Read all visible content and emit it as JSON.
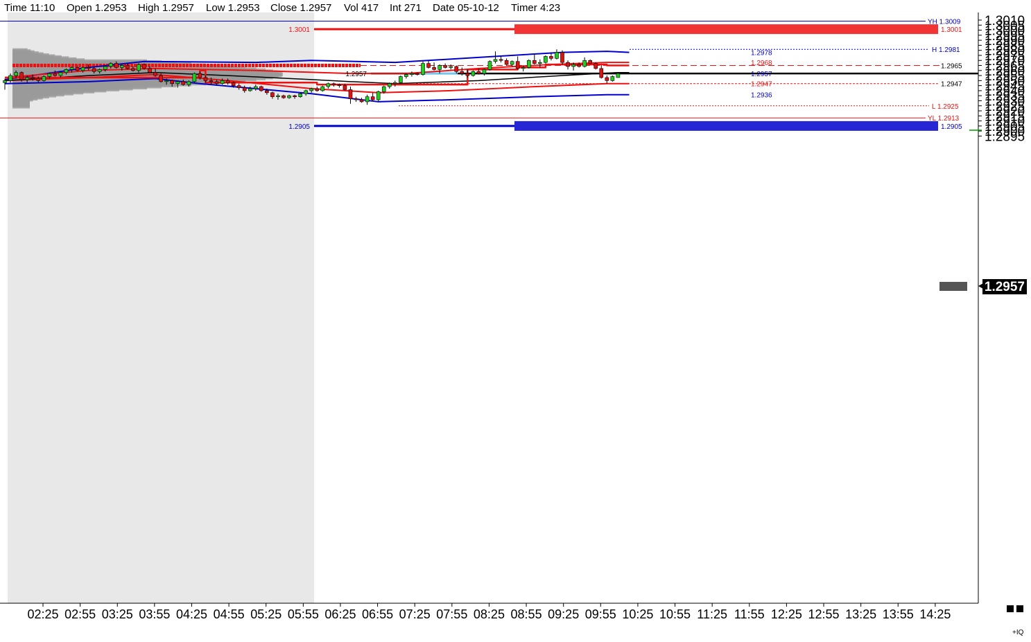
{
  "header": {
    "time": "Time 11:10",
    "open": "Open 1.2953",
    "high": "High 1.2957",
    "low": "Low 1.2953",
    "close": "Close 1.2957",
    "vol": "Vol 417",
    "int": "Int 271",
    "date": "Date 05-10-12",
    "timer": "Timer 4:23"
  },
  "corner_label": "+IQ",
  "colors": {
    "red": "#ee1111",
    "blue": "#0000cc",
    "black": "#000000",
    "green": "#22cc22",
    "candle_red": "#dd1111",
    "profile_gray": "#9a9a9a",
    "shade": "#e8e8e8"
  },
  "chart_data": {
    "type": "candlestick",
    "ylim": [
      1.2893,
      1.3013
    ],
    "y_ticks": [
      "1.3010",
      "1.3005",
      "1.3000",
      "1.2995",
      "1.2990",
      "1.2985",
      "1.2980",
      "1.2975",
      "1.2970",
      "1.2965",
      "1.2960",
      "1.2955",
      "1.2950",
      "1.2945",
      "1.2940",
      "1.2935",
      "1.2930",
      "1.2925",
      "1.2920",
      "1.2915",
      "1.2910",
      "1.2905",
      "1.2900",
      "1.2895"
    ],
    "x_ticks": [
      "02:25",
      "02:55",
      "03:25",
      "03:55",
      "04:25",
      "04:55",
      "05:25",
      "05:55",
      "06:25",
      "06:55",
      "07:25",
      "07:55",
      "08:25",
      "08:55",
      "09:25",
      "09:55",
      "10:25",
      "10:55",
      "11:25",
      "11:55",
      "12:25",
      "12:55",
      "13:25",
      "13:55",
      "14:25"
    ],
    "current_price": "1.2957",
    "levels": [
      {
        "name": "yh",
        "label": "YH 1.3009",
        "value": 1.3009,
        "color": "#0000cc"
      },
      {
        "name": "high",
        "label": "H 1.2981",
        "value": 1.2981,
        "color": "#0000cc"
      },
      {
        "name": "resist",
        "label": "1.3001",
        "value": 1.3001,
        "color": "#ee1111"
      },
      {
        "name": "poc",
        "label": "1.2965",
        "value": 1.2965,
        "color": "#ee1111"
      },
      {
        "name": "close",
        "label": "1.2957",
        "value": 1.2957,
        "color": "#000000"
      },
      {
        "name": "val",
        "label": "1.2947",
        "value": 1.2947,
        "color": "#ee1111"
      },
      {
        "name": "low",
        "label": "L 1.2925",
        "value": 1.2925,
        "color": "#ee1111"
      },
      {
        "name": "yl",
        "label": "YL 1.2913",
        "value": 1.2913,
        "color": "#ee1111"
      },
      {
        "name": "support",
        "label": "1.2905",
        "value": 1.2905,
        "color": "#0000cc"
      }
    ],
    "band_labels": [
      {
        "label": "1.2978",
        "value": 1.2978,
        "color": "#0000cc"
      },
      {
        "label": "1.2968",
        "value": 1.2968,
        "color": "#ee1111"
      },
      {
        "label": "1.2957",
        "value": 1.2957,
        "color": "#0000cc"
      },
      {
        "label": "1.2947",
        "value": 1.2947,
        "color": "#ee1111"
      },
      {
        "label": "1.2936",
        "value": 1.2936,
        "color": "#0000cc"
      }
    ],
    "candles": [
      [
        1.2948,
        1.2952,
        1.2941,
        1.295
      ],
      [
        1.295,
        1.2957,
        1.2948,
        1.2955
      ],
      [
        1.2955,
        1.296,
        1.2952,
        1.2958
      ],
      [
        1.2958,
        1.2959,
        1.2949,
        1.2951
      ],
      [
        1.2951,
        1.2955,
        1.2948,
        1.2953
      ],
      [
        1.2953,
        1.2956,
        1.295,
        1.2952
      ],
      [
        1.2952,
        1.2954,
        1.2948,
        1.295
      ],
      [
        1.295,
        1.2955,
        1.2949,
        1.2954
      ],
      [
        1.2954,
        1.2958,
        1.2952,
        1.2957
      ],
      [
        1.2957,
        1.296,
        1.2954,
        1.2955
      ],
      [
        1.2955,
        1.2959,
        1.2953,
        1.2958
      ],
      [
        1.2958,
        1.2962,
        1.2956,
        1.2961
      ],
      [
        1.2961,
        1.2964,
        1.2958,
        1.2963
      ],
      [
        1.2963,
        1.2965,
        1.2959,
        1.296
      ],
      [
        1.296,
        1.2964,
        1.2958,
        1.2963
      ],
      [
        1.2963,
        1.2966,
        1.296,
        1.2962
      ],
      [
        1.2962,
        1.2964,
        1.2957,
        1.2959
      ],
      [
        1.2959,
        1.2962,
        1.2957,
        1.2961
      ],
      [
        1.2961,
        1.2965,
        1.2959,
        1.2964
      ],
      [
        1.2964,
        1.2968,
        1.2962,
        1.2967
      ],
      [
        1.2967,
        1.2969,
        1.2962,
        1.2963
      ],
      [
        1.2963,
        1.2966,
        1.296,
        1.2965
      ],
      [
        1.2965,
        1.2967,
        1.2961,
        1.2962
      ],
      [
        1.2962,
        1.2964,
        1.2959,
        1.296
      ],
      [
        1.296,
        1.2967,
        1.2958,
        1.2966
      ],
      [
        1.2966,
        1.2967,
        1.2961,
        1.2962
      ],
      [
        1.2962,
        1.2964,
        1.2957,
        1.2958
      ],
      [
        1.2958,
        1.2962,
        1.2954,
        1.2955
      ],
      [
        1.2955,
        1.2957,
        1.2948,
        1.2949
      ],
      [
        1.2949,
        1.2952,
        1.2946,
        1.295
      ],
      [
        1.295,
        1.2951,
        1.2944,
        1.2947
      ],
      [
        1.2947,
        1.295,
        1.2943,
        1.2949
      ],
      [
        1.2949,
        1.2951,
        1.2945,
        1.2946
      ],
      [
        1.2946,
        1.295,
        1.2944,
        1.2949
      ],
      [
        1.2949,
        1.2958,
        1.2948,
        1.2957
      ],
      [
        1.2957,
        1.2959,
        1.2951,
        1.2953
      ],
      [
        1.2953,
        1.2955,
        1.2948,
        1.295
      ],
      [
        1.295,
        1.2953,
        1.2946,
        1.2949
      ],
      [
        1.2949,
        1.2951,
        1.2945,
        1.2947
      ],
      [
        1.2947,
        1.2952,
        1.2946,
        1.295
      ],
      [
        1.295,
        1.2952,
        1.2946,
        1.2948
      ],
      [
        1.2948,
        1.2949,
        1.2943,
        1.2945
      ],
      [
        1.2945,
        1.2947,
        1.2941,
        1.2943
      ],
      [
        1.2943,
        1.2945,
        1.2938,
        1.294
      ],
      [
        1.294,
        1.2944,
        1.2939,
        1.2942
      ],
      [
        1.2942,
        1.2946,
        1.294,
        1.2944
      ],
      [
        1.2944,
        1.2945,
        1.2939,
        1.294
      ],
      [
        1.294,
        1.2942,
        1.2936,
        1.2938
      ],
      [
        1.2938,
        1.2939,
        1.2932,
        1.2934
      ],
      [
        1.2934,
        1.2937,
        1.2931,
        1.2935
      ],
      [
        1.2935,
        1.2936,
        1.2932,
        1.2933
      ],
      [
        1.2933,
        1.2936,
        1.2932,
        1.2935
      ],
      [
        1.2935,
        1.2936,
        1.2932,
        1.2934
      ],
      [
        1.2934,
        1.2938,
        1.2933,
        1.2937
      ],
      [
        1.2937,
        1.2941,
        1.2935,
        1.294
      ],
      [
        1.294,
        1.2943,
        1.2938,
        1.2942
      ],
      [
        1.2942,
        1.2944,
        1.2939,
        1.294
      ],
      [
        1.294,
        1.2945,
        1.2939,
        1.2944
      ],
      [
        1.2944,
        1.2948,
        1.2942,
        1.2947
      ],
      [
        1.2947,
        1.2948,
        1.2944,
        1.2946
      ],
      [
        1.2946,
        1.2947,
        1.2943,
        1.2945
      ],
      [
        1.2945,
        1.2947,
        1.294,
        1.2941
      ],
      [
        1.2941,
        1.2944,
        1.2927,
        1.2932
      ],
      [
        1.2932,
        1.2934,
        1.2929,
        1.2931
      ],
      [
        1.2931,
        1.2933,
        1.2928,
        1.2929
      ],
      [
        1.2929,
        1.2936,
        1.2926,
        1.2934
      ],
      [
        1.2934,
        1.2938,
        1.293,
        1.2931
      ],
      [
        1.2931,
        1.294,
        1.2929,
        1.2939
      ],
      [
        1.2939,
        1.2945,
        1.2937,
        1.2944
      ],
      [
        1.2944,
        1.2948,
        1.2942,
        1.2947
      ],
      [
        1.2947,
        1.295,
        1.2944,
        1.2948
      ],
      [
        1.2948,
        1.2955,
        1.2947,
        1.2954
      ],
      [
        1.2954,
        1.2957,
        1.2952,
        1.2956
      ],
      [
        1.2956,
        1.2959,
        1.2954,
        1.2957
      ],
      [
        1.2957,
        1.2958,
        1.2955,
        1.2956
      ],
      [
        1.2956,
        1.2969,
        1.2955,
        1.2967
      ],
      [
        1.2967,
        1.297,
        1.2962,
        1.2963
      ],
      [
        1.2963,
        1.2968,
        1.296,
        1.2961
      ],
      [
        1.2961,
        1.2966,
        1.2957,
        1.2965
      ],
      [
        1.2965,
        1.2967,
        1.2962,
        1.2963
      ],
      [
        1.2963,
        1.2966,
        1.2961,
        1.2964
      ],
      [
        1.2964,
        1.2965,
        1.2957,
        1.2959
      ],
      [
        1.2959,
        1.2963,
        1.2955,
        1.2957
      ],
      [
        1.2957,
        1.2961,
        1.2953,
        1.2955
      ],
      [
        1.2955,
        1.296,
        1.2954,
        1.2959
      ],
      [
        1.2959,
        1.2962,
        1.2956,
        1.2957
      ],
      [
        1.2957,
        1.2962,
        1.2955,
        1.2961
      ],
      [
        1.2961,
        1.297,
        1.296,
        1.2969
      ],
      [
        1.2969,
        1.2979,
        1.2967,
        1.2971
      ],
      [
        1.2971,
        1.2975,
        1.2968,
        1.297
      ],
      [
        1.297,
        1.2972,
        1.2965,
        1.2966
      ],
      [
        1.2966,
        1.297,
        1.2964,
        1.2969
      ],
      [
        1.2969,
        1.2974,
        1.2961,
        1.2962
      ],
      [
        1.2962,
        1.2965,
        1.2959,
        1.2963
      ],
      [
        1.2963,
        1.2971,
        1.2962,
        1.297
      ],
      [
        1.297,
        1.2976,
        1.2966,
        1.2967
      ],
      [
        1.2967,
        1.2971,
        1.2963,
        1.2968
      ],
      [
        1.2968,
        1.2975,
        1.2967,
        1.2974
      ],
      [
        1.2974,
        1.2978,
        1.297,
        1.2972
      ],
      [
        1.2972,
        1.2981,
        1.2971,
        1.2978
      ],
      [
        1.2978,
        1.298,
        1.2966,
        1.2968
      ],
      [
        1.2968,
        1.297,
        1.2961,
        1.2964
      ],
      [
        1.2964,
        1.2968,
        1.296,
        1.2966
      ],
      [
        1.2966,
        1.2968,
        1.2963,
        1.2964
      ],
      [
        1.2964,
        1.2973,
        1.2963,
        1.297
      ],
      [
        1.297,
        1.2971,
        1.2966,
        1.2967
      ],
      [
        1.2967,
        1.2968,
        1.2961,
        1.2962
      ],
      [
        1.2962,
        1.2965,
        1.2952,
        1.2953
      ],
      [
        1.2953,
        1.2955,
        1.2947,
        1.295
      ],
      [
        1.295,
        1.2955,
        1.2949,
        1.2954
      ],
      [
        1.2953,
        1.2957,
        1.2953,
        1.2957
      ]
    ],
    "overlays": {
      "vwap_black": [
        [
          0,
          1.295
        ],
        [
          15,
          1.2955
        ],
        [
          27,
          1.2958
        ],
        [
          40,
          1.2955
        ],
        [
          55,
          1.2951
        ],
        [
          62,
          1.2949
        ],
        [
          70,
          1.2947
        ],
        [
          85,
          1.295
        ],
        [
          100,
          1.2955
        ],
        [
          110,
          1.2958
        ],
        [
          112,
          1.2958
        ]
      ],
      "upper_red": [
        [
          0,
          1.2953
        ],
        [
          15,
          1.296
        ],
        [
          27,
          1.2962
        ],
        [
          45,
          1.296
        ],
        [
          62,
          1.2957
        ],
        [
          72,
          1.2957
        ],
        [
          85,
          1.2962
        ],
        [
          98,
          1.2966
        ],
        [
          108,
          1.2968
        ],
        [
          112,
          1.2968
        ]
      ],
      "upper_blue": [
        [
          0,
          1.2951
        ],
        [
          15,
          1.2963
        ],
        [
          25,
          1.2969
        ],
        [
          45,
          1.2968
        ],
        [
          55,
          1.297
        ],
        [
          70,
          1.2968
        ],
        [
          85,
          1.2973
        ],
        [
          100,
          1.2978
        ],
        [
          108,
          1.2979
        ],
        [
          112,
          1.2978
        ]
      ],
      "lower_red": [
        [
          0,
          1.295
        ],
        [
          15,
          1.2953
        ],
        [
          27,
          1.2956
        ],
        [
          40,
          1.295
        ],
        [
          55,
          1.2942
        ],
        [
          67,
          1.2938
        ],
        [
          80,
          1.294
        ],
        [
          95,
          1.2944
        ],
        [
          108,
          1.2947
        ],
        [
          112,
          1.2947
        ]
      ],
      "lower_blue": [
        [
          0,
          1.2947
        ],
        [
          15,
          1.2949
        ],
        [
          27,
          1.2952
        ],
        [
          35,
          1.2947
        ],
        [
          55,
          1.2937
        ],
        [
          67,
          1.2929
        ],
        [
          80,
          1.2931
        ],
        [
          95,
          1.2934
        ],
        [
          108,
          1.2936
        ],
        [
          112,
          1.2936
        ]
      ],
      "poc_red_step": [
        [
          0,
          1.2953
        ],
        [
          35,
          1.296
        ],
        [
          36,
          1.2948
        ],
        [
          55,
          1.2948
        ],
        [
          56,
          1.2946
        ],
        [
          82,
          1.2946
        ],
        [
          83,
          1.2961
        ],
        [
          92,
          1.2963
        ],
        [
          97,
          1.2966
        ],
        [
          108,
          1.2965
        ],
        [
          112,
          1.2965
        ]
      ]
    }
  }
}
